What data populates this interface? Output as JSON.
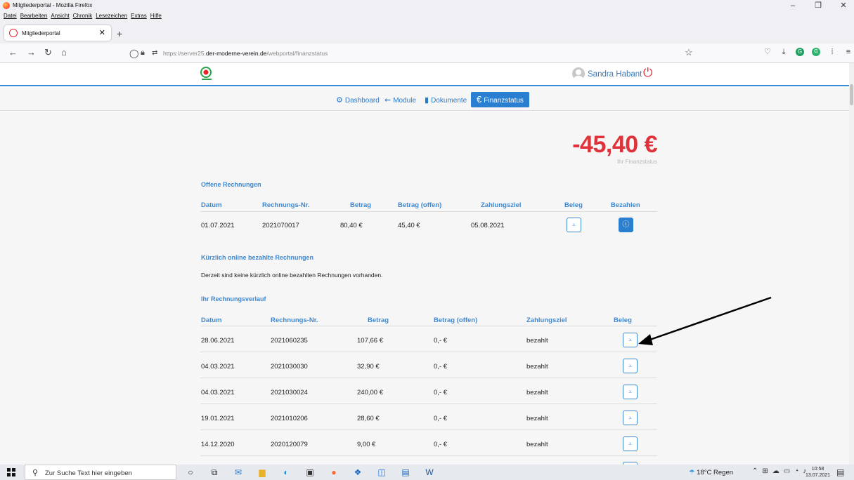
{
  "window": {
    "title": "Mitgliederportal - Mozilla Firefox",
    "controls": [
      "–",
      "❐",
      "✕"
    ]
  },
  "menu": [
    "Datei",
    "Bearbeiten",
    "Ansicht",
    "Chronik",
    "Lesezeichen",
    "Extras",
    "Hilfe"
  ],
  "tab": {
    "title": "Mitgliederportal",
    "close": "✕",
    "new": "+"
  },
  "nav": {
    "back": "←",
    "forward": "→",
    "reload": "↻",
    "home": "⌂",
    "url_prefix": "https://server25.",
    "url_domain": "der-moderne-verein.de",
    "url_path": "/webportal/finanzstatus"
  },
  "header": {
    "user_name": "Sandra Habant",
    "power_icon": "⏻"
  },
  "subnav": {
    "items": [
      {
        "label": "Dashboard",
        "icon": "⚙"
      },
      {
        "label": "Module",
        "icon": "⇜"
      },
      {
        "label": "Dokumente",
        "icon": "▮"
      }
    ],
    "active": {
      "label": "Finanzstatus",
      "icon": "€"
    }
  },
  "balance": {
    "amount": "-45,40 €",
    "label": "Ihr Finanzstatus",
    "color": "#e0323a"
  },
  "open_invoices": {
    "title": "Offene Rechnungen",
    "columns": [
      "Datum",
      "Rechnungs-Nr.",
      "Betrag",
      "Betrag (offen)",
      "Zahlungsziel",
      "Beleg",
      "Bezahlen"
    ],
    "rows": [
      {
        "date": "01.07.2021",
        "number": "2021070017",
        "amount": "80,40 €",
        "open": "45,40 €",
        "due": "05.08.2021"
      }
    ]
  },
  "recent_paid": {
    "title": "Kürzlich online bezahlte Rechnungen",
    "message": "Derzeit sind keine kürzlich online bezahlten Rechnungen vorhanden."
  },
  "history": {
    "title": "Ihr Rechnungsverlauf",
    "columns": [
      "Datum",
      "Rechnungs-Nr.",
      "Betrag",
      "Betrag (offen)",
      "Zahlungsziel",
      "Beleg"
    ],
    "rows": [
      {
        "date": "28.06.2021",
        "number": "2021060235",
        "amount": "107,66 €",
        "open": "0,- €",
        "due": "bezahlt"
      },
      {
        "date": "04.03.2021",
        "number": "2021030030",
        "amount": "32,90 €",
        "open": "0,- €",
        "due": "bezahlt"
      },
      {
        "date": "04.03.2021",
        "number": "2021030024",
        "amount": "240,00 €",
        "open": "0,- €",
        "due": "bezahlt"
      },
      {
        "date": "19.01.2021",
        "number": "2021010206",
        "amount": "28,60 €",
        "open": "0,- €",
        "due": "bezahlt"
      },
      {
        "date": "14.12.2020",
        "number": "2020120079",
        "amount": "9,00 €",
        "open": "0,- €",
        "due": "bezahlt"
      }
    ]
  },
  "taskbar": {
    "search_placeholder": "Zur Suche Text hier eingeben",
    "weather": "18°C Regen",
    "time": "10:58",
    "date": "13.07.2021"
  },
  "colors": {
    "accent": "#2a7fd0",
    "negative": "#e0323a",
    "divider": "#3d8ad6"
  }
}
